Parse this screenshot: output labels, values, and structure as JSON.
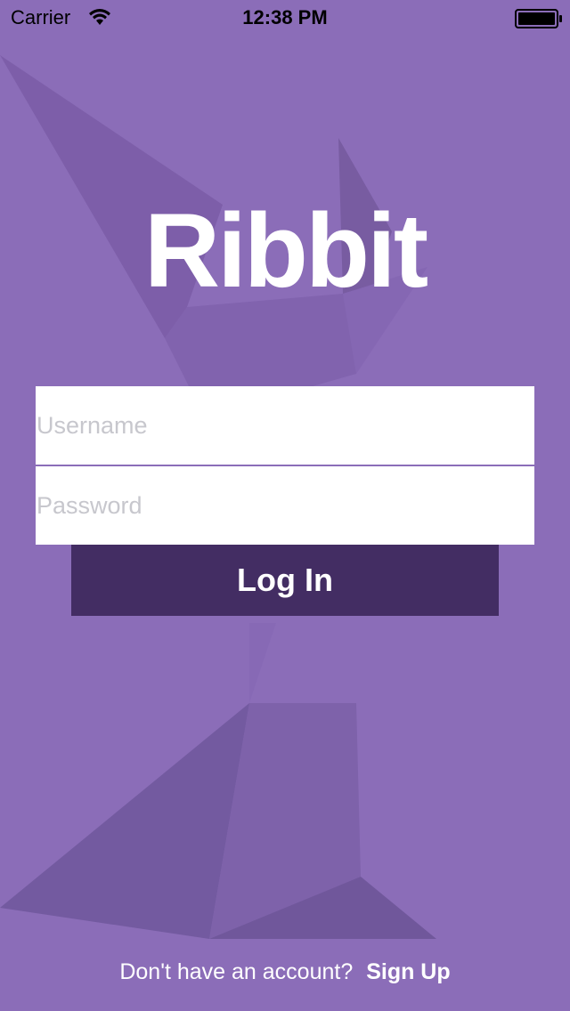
{
  "status_bar": {
    "carrier": "Carrier",
    "time": "12:38 PM",
    "wifi_icon": "wifi-icon",
    "battery_icon": "battery-icon"
  },
  "logo": {
    "title": "Ribbit"
  },
  "form": {
    "username_placeholder": "Username",
    "password_placeholder": "Password",
    "login_label": "Log In"
  },
  "footer": {
    "prompt": "Don't have an account?",
    "signup_label": "Sign Up"
  },
  "colors": {
    "background": "#8b6db8",
    "button": "#432d63",
    "text": "#ffffff",
    "placeholder": "#c7c7cd"
  }
}
